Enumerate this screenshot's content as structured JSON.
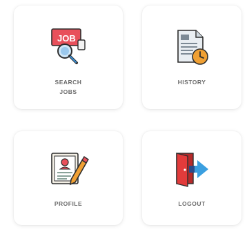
{
  "tiles": {
    "search_jobs": {
      "label_line1": "SEARCH",
      "label_line2": "JOBS",
      "icon": "job-search-icon"
    },
    "history": {
      "label": "HISTORY",
      "icon": "history-document-clock-icon"
    },
    "profile": {
      "label": "PROFILE",
      "icon": "profile-edit-icon"
    },
    "logout": {
      "label": "LOGOUT",
      "icon": "logout-door-arrow-icon"
    }
  },
  "colors": {
    "card_bg": "#ffffff",
    "label_text": "#6b6b6b",
    "job_red": "#e8505b",
    "magnifier_blue": "#3a8fd6",
    "clock_orange": "#f0a033",
    "door_red": "#e23b3b",
    "arrow_blue": "#3b9fe0"
  }
}
